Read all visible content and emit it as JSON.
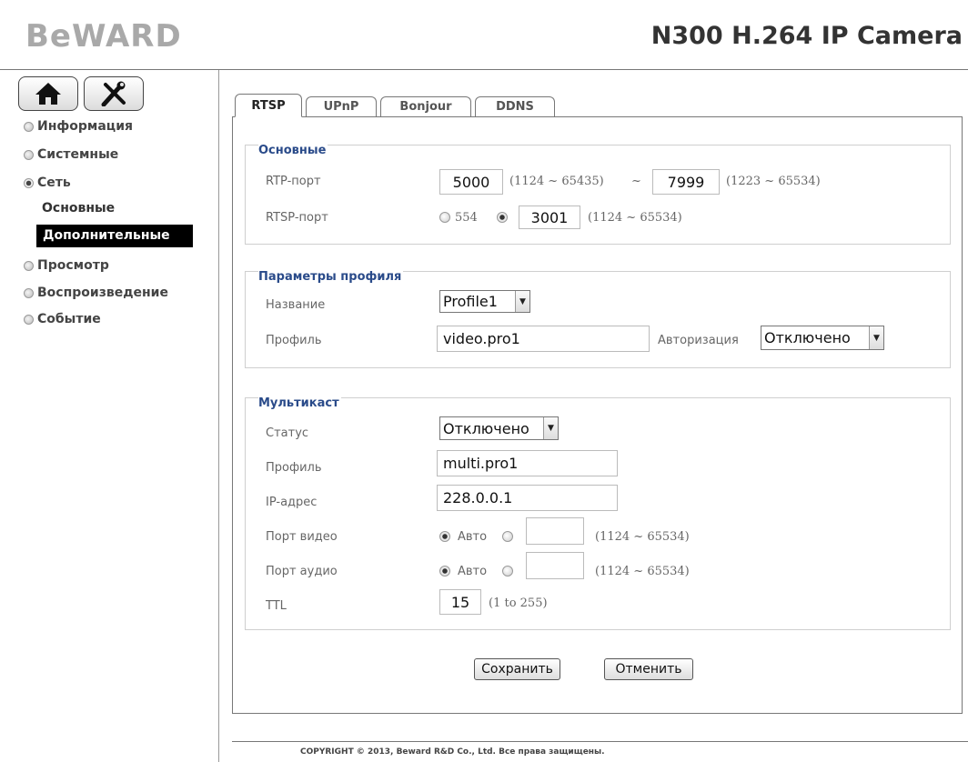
{
  "header": {
    "logo": "BeWARD",
    "model": "N300 H.264 IP Camera"
  },
  "sidebar": {
    "items": [
      {
        "label": "Информация"
      },
      {
        "label": "Системные"
      },
      {
        "label": "Сеть"
      },
      {
        "label": "Просмотр"
      },
      {
        "label": "Воспроизведение"
      },
      {
        "label": "Событие"
      }
    ],
    "subitems": [
      {
        "label": "Основные"
      },
      {
        "label": "Дополнительные"
      }
    ]
  },
  "tabs": [
    {
      "label": "RTSP"
    },
    {
      "label": "UPnP"
    },
    {
      "label": "Bonjour"
    },
    {
      "label": "DDNS"
    }
  ],
  "basic": {
    "legend": "Основные",
    "rtp_label": "RTP-порт",
    "rtp_from": "5000",
    "rtp_from_range": "(1124 ~ 65435)",
    "rtp_sep": "~",
    "rtp_to": "7999",
    "rtp_to_range": "(1223 ~ 65534)",
    "rtsp_label": "RTSP-порт",
    "rtsp_default": "554",
    "rtsp_custom": "3001",
    "rtsp_range": "(1124 ~ 65534)"
  },
  "profile": {
    "legend": "Параметры профиля",
    "name_label": "Название",
    "name_value": "Profile1",
    "profile_label": "Профиль",
    "profile_value": "video.pro1",
    "auth_label": "Авторизация",
    "auth_value": "Отключено"
  },
  "multicast": {
    "legend": "Мультикаст",
    "status_label": "Статус",
    "status_value": "Отключено",
    "profile_label": "Профиль",
    "profile_value": "multi.pro1",
    "ip_label": "IP-адрес",
    "ip_value": "228.0.0.1",
    "video_port_label": "Порт видео",
    "video_auto": "Авто",
    "video_range": "(1124 ~ 65534)",
    "audio_port_label": "Порт аудио",
    "audio_auto": "Авто",
    "audio_range": "(1124 ~ 65534)",
    "ttl_label": "TTL",
    "ttl_value": "15",
    "ttl_range": "(1 to 255)"
  },
  "actions": {
    "save": "Сохранить",
    "cancel": "Отменить"
  },
  "footer": {
    "copyright": "COPYRIGHT © 2013, Beward R&D Co., Ltd. Все права защищены."
  }
}
